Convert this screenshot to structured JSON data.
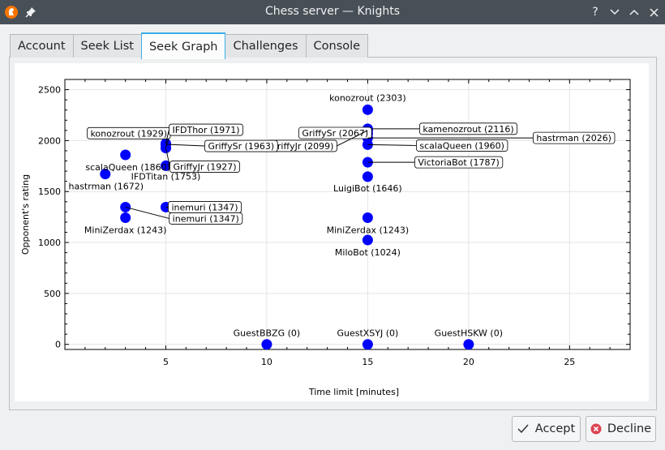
{
  "window": {
    "title": "Chess server — Knights",
    "help_label": "?",
    "minimize_label": "﹀",
    "maximize_label": "︿",
    "close_label": "✕"
  },
  "tabs": [
    {
      "label": "Account"
    },
    {
      "label": "Seek List"
    },
    {
      "label": "Seek Graph"
    },
    {
      "label": "Challenges"
    },
    {
      "label": "Console"
    }
  ],
  "active_tab": "Seek Graph",
  "buttons": {
    "accept_label": "Accept",
    "decline_label": "Decline"
  },
  "colors": {
    "point": "#0000ff",
    "titlebar": "#475057",
    "accent": "#3daee9",
    "decline_icon": "#da4453"
  },
  "chart_data": {
    "type": "scatter",
    "xlabel": "Time limit [minutes]",
    "ylabel": "Opponent's rating",
    "xlim": [
      0,
      28
    ],
    "ylim": [
      -50,
      2600
    ],
    "xticks": [
      5,
      10,
      15,
      20,
      25
    ],
    "yticks": [
      0,
      500,
      1000,
      1500,
      2000,
      2500
    ],
    "grid": true,
    "points": [
      {
        "label": "konozrout (2303)",
        "x": 15,
        "y": 2303
      },
      {
        "label": "kamenozrout (2116)",
        "x": 15,
        "y": 2116
      },
      {
        "label": "GriffySr (2067)",
        "x": 15,
        "y": 2067
      },
      {
        "label": "hastrman (2026)",
        "x": 15,
        "y": 2026
      },
      {
        "label": "GriffyJr (2099)",
        "x": 15,
        "y": 2099
      },
      {
        "label": "scalaQueen (1960)",
        "x": 15,
        "y": 1960
      },
      {
        "label": "VictoriaBot (1787)",
        "x": 15,
        "y": 1787
      },
      {
        "label": "LuigiBot (1646)",
        "x": 15,
        "y": 1646
      },
      {
        "label": "MiniZerdax (1243)",
        "x": 15,
        "y": 1243
      },
      {
        "label": "MiloBot (1024)",
        "x": 15,
        "y": 1024
      },
      {
        "label": "konozrout (1929)",
        "x": 5,
        "y": 1929
      },
      {
        "label": "IFDThor (1971)",
        "x": 5,
        "y": 1971
      },
      {
        "label": "GriffySr (1963)",
        "x": 5,
        "y": 1963
      },
      {
        "label": "GriffyJr (1927)",
        "x": 5,
        "y": 1927
      },
      {
        "label": "IFDTitan (1753)",
        "x": 5,
        "y": 1753
      },
      {
        "label": "inemuri (1347)",
        "x": 5,
        "y": 1347
      },
      {
        "label": "inemuri (1347)",
        "x": 3,
        "y": 1347
      },
      {
        "label": "scalaQueen (1860)",
        "x": 3,
        "y": 1860
      },
      {
        "label": "hastrman (1672)",
        "x": 2,
        "y": 1672
      },
      {
        "label": "MiniZerdax (1243)",
        "x": 3,
        "y": 1243
      },
      {
        "label": "GuestBBZG (0)",
        "x": 10,
        "y": 0
      },
      {
        "label": "GuestXSYJ (0)",
        "x": 15,
        "y": 0
      },
      {
        "label": "GuestHSKW (0)",
        "x": 20,
        "y": 0
      }
    ]
  }
}
